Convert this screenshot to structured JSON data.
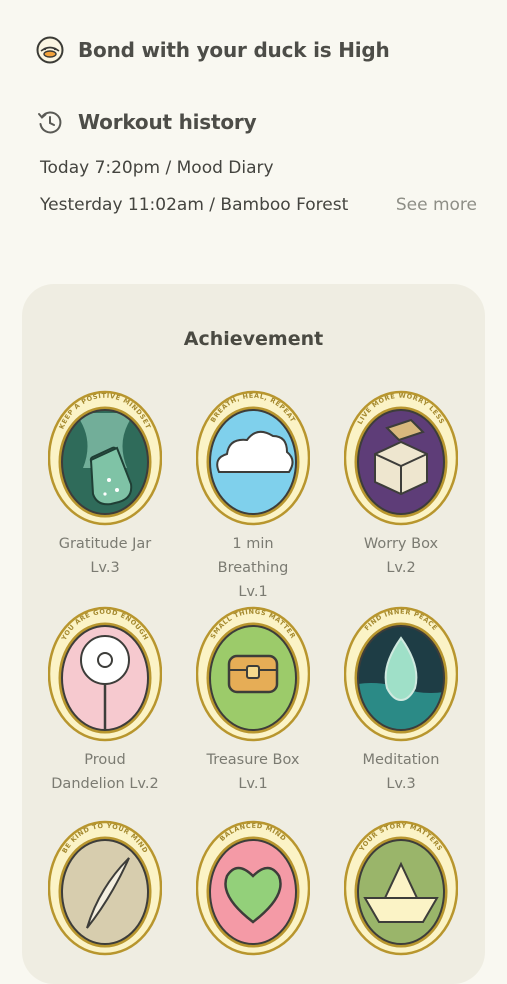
{
  "bond": {
    "text": "Bond with your duck is High",
    "icon": "duck-icon"
  },
  "history": {
    "title": "Workout history",
    "icon": "history-icon",
    "entries": [
      "Today 7:20pm / Mood Diary",
      "Yesterday 11:02am / Bamboo Forest"
    ],
    "see_more": "See more"
  },
  "achievement": {
    "title": "Achievement",
    "badges": [
      {
        "name": "Gratitude Jar",
        "level": "Lv.3",
        "motto": "KEEP A POSITIVE MINDSET",
        "icon": "jar-icon"
      },
      {
        "name": "1 min Breathing",
        "level": "Lv.1",
        "motto": "BREATH, HEAL, REPEAT",
        "icon": "cloud-icon"
      },
      {
        "name": "Worry Box",
        "level": "Lv.2",
        "motto": "LIVE MORE WORRY LESS",
        "icon": "box-icon"
      },
      {
        "name": "Proud",
        "level": "Dandelion Lv.2",
        "motto": "YOU ARE GOOD ENOUGH",
        "icon": "dandelion-icon"
      },
      {
        "name": "Treasure Box",
        "level": "Lv.1",
        "motto": "SMALL THINGS MATTER",
        "icon": "treasure-icon"
      },
      {
        "name": "Meditation",
        "level": "Lv.3",
        "motto": "FIND INNER PEACE",
        "icon": "flame-icon"
      },
      {
        "name": "",
        "level": "",
        "motto": "BE KIND TO YOUR MIND",
        "icon": "feather-icon"
      },
      {
        "name": "",
        "level": "",
        "motto": "BALANCED MIND",
        "icon": "heart-icon"
      },
      {
        "name": "",
        "level": "",
        "motto": "YOUR STORY MATTERS",
        "icon": "paper-boat-icon"
      }
    ]
  },
  "colors": {
    "background": "#f9f8f1",
    "card": "#efede2",
    "badge_rim": "#b8962e",
    "badge_ring": "#fbf3c6"
  }
}
